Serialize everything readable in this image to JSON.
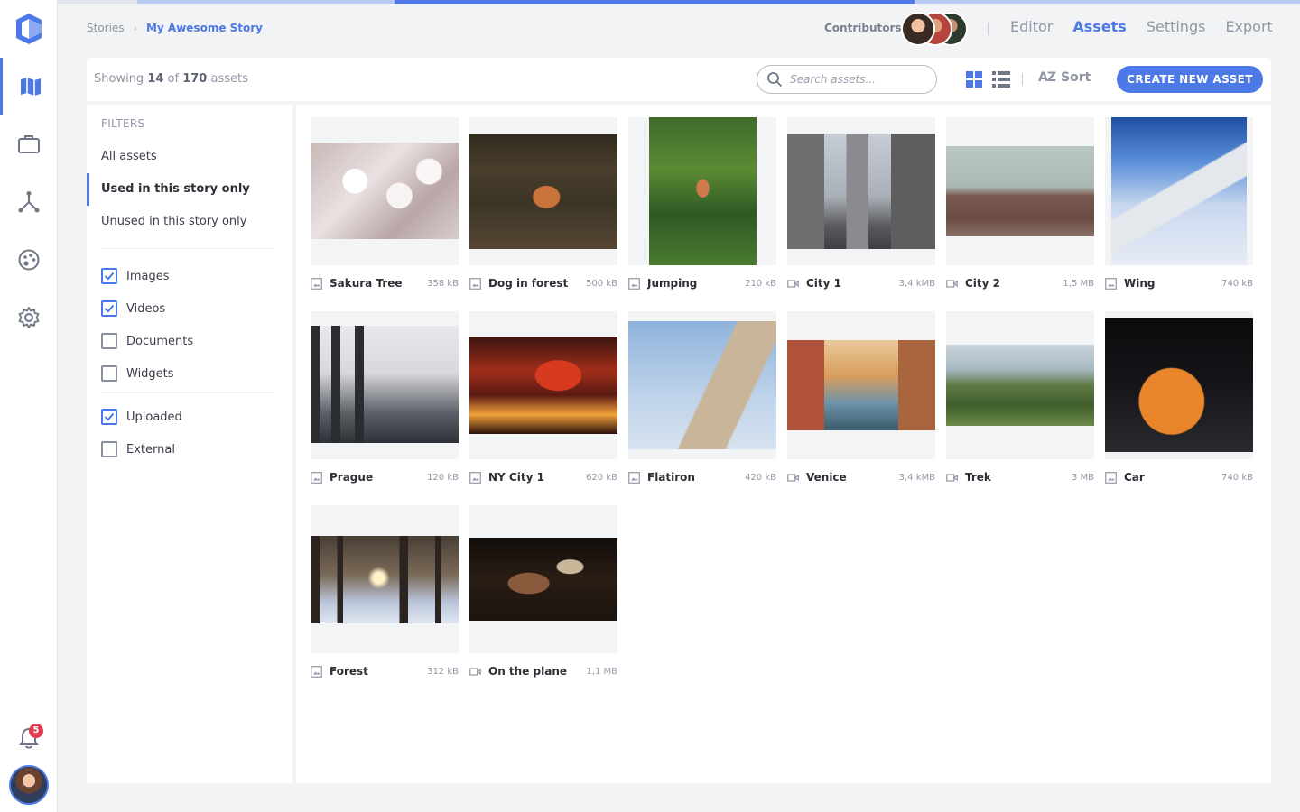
{
  "breadcrumb": {
    "root": "Stories",
    "current": "My Awesome Story"
  },
  "header": {
    "contributors_label": "Contributors",
    "tabs": [
      {
        "label": "Editor",
        "active": false
      },
      {
        "label": "Assets",
        "active": true
      },
      {
        "label": "Settings",
        "active": false
      },
      {
        "label": "Export",
        "active": false
      }
    ]
  },
  "toolbar": {
    "showing_prefix": "Showing ",
    "shown_count": "14",
    "of_word": " of ",
    "total_count": "170",
    "suffix": " assets",
    "search_placeholder": "Search assets...",
    "sort_label": "Sort",
    "sort_icon_text": "AZ",
    "create_label": "CREATE NEW ASSET"
  },
  "filters": {
    "title": "FILTERS",
    "options": [
      "All assets",
      "Used in this story only",
      "Unused in this story only"
    ],
    "active_option": "Used in this story only",
    "types": [
      {
        "label": "Images",
        "checked": true
      },
      {
        "label": "Videos",
        "checked": true
      },
      {
        "label": "Documents",
        "checked": false
      },
      {
        "label": "Widgets",
        "checked": false
      }
    ],
    "sources": [
      {
        "label": "Uploaded",
        "checked": true
      },
      {
        "label": "External",
        "checked": false
      }
    ]
  },
  "notifications": {
    "count": "5"
  },
  "assets": [
    {
      "name": "Sakura Tree",
      "size": "358 kB",
      "type": "image"
    },
    {
      "name": "Dog in forest",
      "size": "500 kB",
      "type": "image"
    },
    {
      "name": "Jumping",
      "size": "210 kB",
      "type": "image"
    },
    {
      "name": "City 1",
      "size": "3,4 kMB",
      "type": "video"
    },
    {
      "name": "City 2",
      "size": "1,5 MB",
      "type": "video"
    },
    {
      "name": "Wing",
      "size": "740 kB",
      "type": "image"
    },
    {
      "name": "Prague",
      "size": "120 kB",
      "type": "image"
    },
    {
      "name": "NY City 1",
      "size": "620 kB",
      "type": "image"
    },
    {
      "name": "Flatiron",
      "size": "420 kB",
      "type": "image"
    },
    {
      "name": "Venice",
      "size": "3,4 kMB",
      "type": "video"
    },
    {
      "name": "Trek",
      "size": "3 MB",
      "type": "video"
    },
    {
      "name": "Car",
      "size": "740 kB",
      "type": "image"
    },
    {
      "name": "Forest",
      "size": "312 kB",
      "type": "image"
    },
    {
      "name": "On the plane",
      "size": "1,1 MB",
      "type": "video"
    }
  ],
  "theme": {
    "accent": "#4c78e8",
    "badge": "#e23b4f"
  }
}
